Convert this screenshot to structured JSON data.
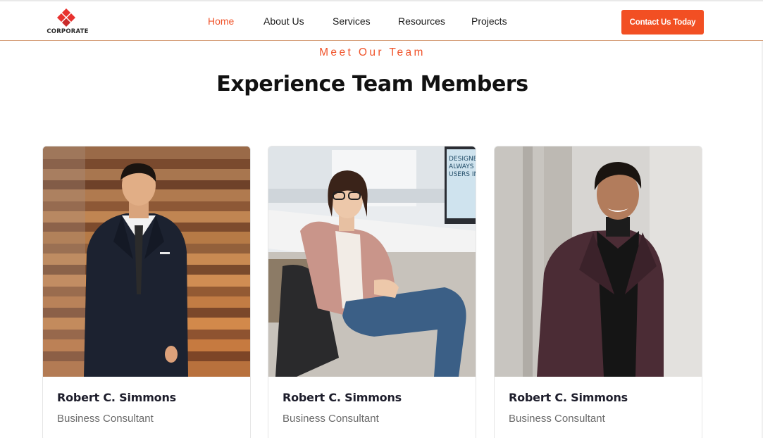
{
  "brand": {
    "name": "CORPORATE",
    "accent": "#f24f23"
  },
  "nav": {
    "items": [
      {
        "label": "Home",
        "active": true
      },
      {
        "label": "About Us",
        "active": false
      },
      {
        "label": "Services",
        "active": false
      },
      {
        "label": "Resources",
        "active": false
      },
      {
        "label": "Projects",
        "active": false
      }
    ],
    "cta_label": "Contact Us Today"
  },
  "team_section": {
    "eyebrow": "Meet Our Team",
    "title": "Experience Team Members",
    "members": [
      {
        "name": "Robert C. Simmons",
        "role": "Business Consultant",
        "photo": "man-in-dark-suit-wood-wall"
      },
      {
        "name": "Robert C. Simmons",
        "role": "Business Consultant",
        "photo": "woman-with-glasses-at-desk"
      },
      {
        "name": "Robert C. Simmons",
        "role": "Business Consultant",
        "photo": "smiling-man-maroon-blazer"
      }
    ],
    "monitor_text": [
      "DESIGNE",
      "ALWAYS",
      "USERS IN"
    ]
  }
}
